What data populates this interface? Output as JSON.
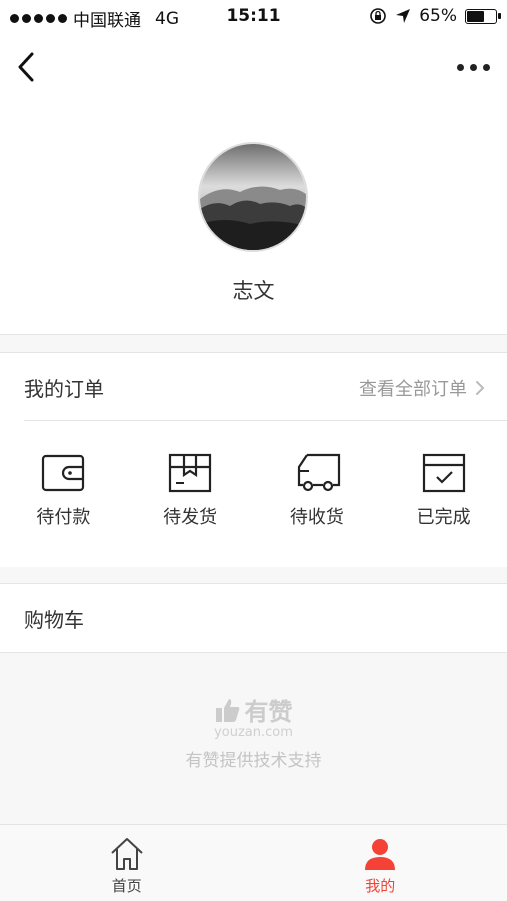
{
  "status_bar": {
    "carrier": "中国联通",
    "network": "4G",
    "time": "15:11",
    "battery": "65%",
    "battery_level": 0.65
  },
  "profile": {
    "nickname": "志文"
  },
  "orders": {
    "title": "我的订单",
    "view_all": "查看全部订单",
    "statuses": [
      {
        "label": "待付款",
        "icon": "wallet-icon"
      },
      {
        "label": "待发货",
        "icon": "package-icon"
      },
      {
        "label": "待收货",
        "icon": "truck-icon"
      },
      {
        "label": "已完成",
        "icon": "check-box-icon"
      }
    ]
  },
  "cart": {
    "title": "购物车"
  },
  "footer": {
    "brand": "有赞",
    "domain": "youzan.com",
    "support": "有赞提供技术支持"
  },
  "tabbar": {
    "items": [
      {
        "label": "首页",
        "icon": "home-icon"
      },
      {
        "label": "我的",
        "icon": "user-icon"
      }
    ]
  },
  "colors": {
    "accent": "#f44336",
    "text": "#333333",
    "muted": "#999999",
    "background": "#f7f7f7"
  }
}
